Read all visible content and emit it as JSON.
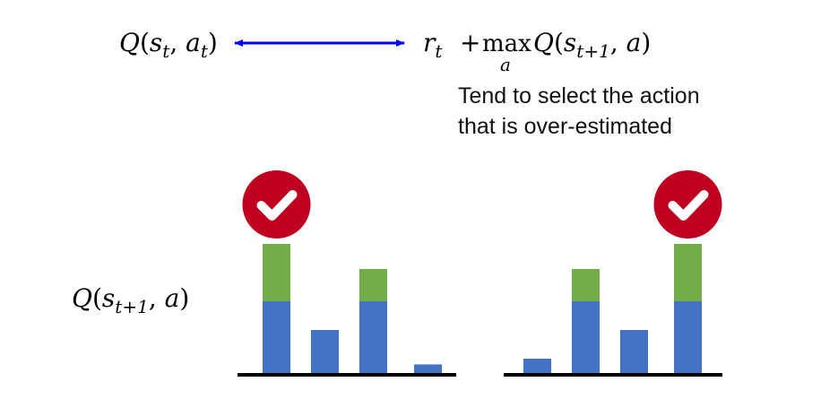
{
  "equation": {
    "lhs": {
      "Q": "Q",
      "open": "(",
      "s": "s",
      "s_sub": "t",
      "comma": ", ",
      "a": "a",
      "a_sub": "t",
      "close": ")"
    },
    "rhs": {
      "r": "r",
      "r_sub": "t",
      "plus": "+",
      "max": "max",
      "max_sub": "a",
      "Q": "Q",
      "open": "(",
      "s": "s",
      "s_sub": "t+1",
      "comma": ", ",
      "a": "a",
      "close": ")"
    }
  },
  "note_lines": [
    "Tend to select the action",
    "that is over-estimated"
  ],
  "axis_label": {
    "Q": "Q",
    "open": "(",
    "s": "s",
    "s_sub": "t+1",
    "comma": ", ",
    "a": "a",
    "close": ")"
  },
  "colors": {
    "arrow": "#0000ff",
    "true_value": "#4472c4",
    "over_estimate": "#70ad47",
    "check_badge": "#c00020",
    "baseline": "#000000"
  },
  "chart_data": [
    {
      "type": "bar",
      "stacked": true,
      "actions": 4,
      "series": [
        {
          "values": [
            10,
            6,
            10,
            1.2
          ]
        },
        {
          "values": [
            8,
            0,
            4.5,
            0
          ]
        }
      ],
      "selected_index": 0,
      "selected_icon": "check-icon"
    },
    {
      "type": "bar",
      "stacked": true,
      "actions": 4,
      "series": [
        {
          "values": [
            2,
            10,
            6,
            10
          ]
        },
        {
          "values": [
            0,
            4.5,
            0,
            8
          ]
        }
      ],
      "selected_index": 3,
      "selected_icon": "check-icon"
    }
  ]
}
